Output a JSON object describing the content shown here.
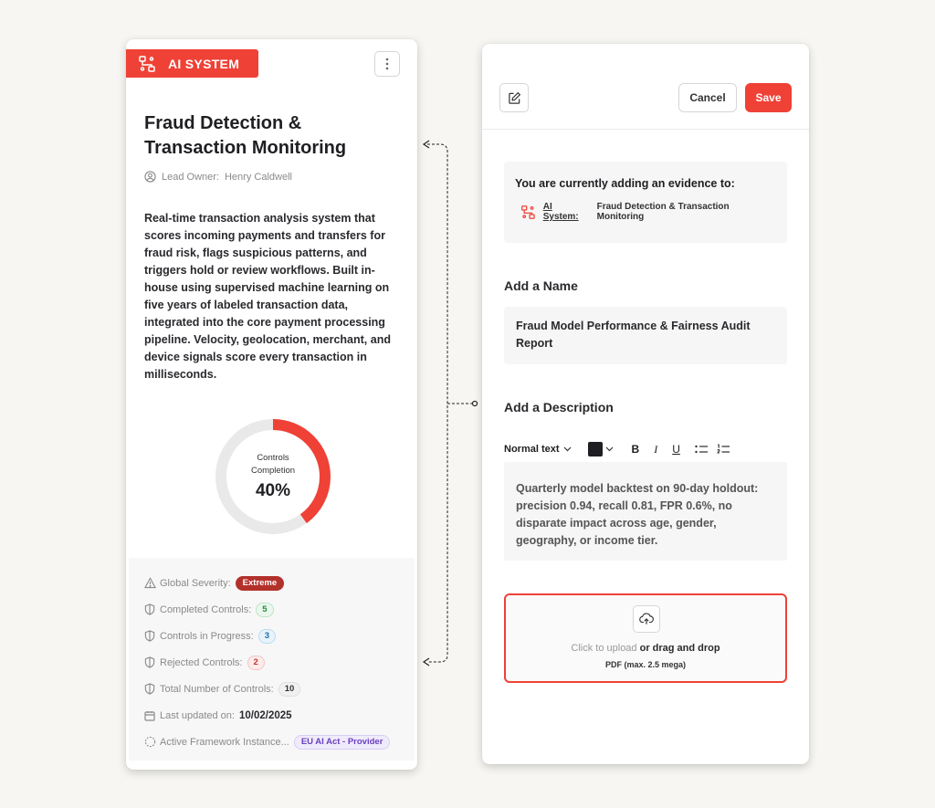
{
  "colors": {
    "accent": "#ef4136",
    "donut_track": "#e9e9e9"
  },
  "system_card": {
    "badge_label": "AI SYSTEM",
    "title": "Fraud Detection & Transaction Monitoring",
    "owner_label": "Lead Owner:",
    "owner_name": "Henry Caldwell",
    "description": "Real-time transaction analysis system that scores incoming payments and transfers for fraud risk, flags suspicious patterns, and triggers hold or review workflows. Built in-house using supervised machine learning on five years of labeled transaction data, integrated into the core payment processing pipeline. Velocity, geolocation, merchant, and device signals score every transaction in milliseconds.",
    "completion": {
      "label": "Controls Completion",
      "value_text": "40%",
      "fraction": 0.4
    },
    "stats": {
      "severity_label": "Global Severity:",
      "severity_value": "Extreme",
      "completed_label": "Completed Controls:",
      "completed_value": "5",
      "in_progress_label": "Controls in Progress:",
      "in_progress_value": "3",
      "rejected_label": "Rejected Controls:",
      "rejected_value": "2",
      "total_label": "Total Number of Controls:",
      "total_value": "10",
      "updated_label": "Last updated on:",
      "updated_value": "10/02/2025",
      "framework_label": "Active Framework Instance...",
      "framework_value": "EU AI Act - Provider"
    }
  },
  "evidence_form": {
    "cancel_label": "Cancel",
    "save_label": "Save",
    "context_title": "You are currently adding an evidence to:",
    "context_ref_label": "AI System:",
    "context_ref_value": "Fraud Detection & Transaction Monitoring",
    "name_heading": "Add a Name",
    "name_value": "Fraud Model Performance & Fairness Audit Report",
    "description_heading": "Add a Description",
    "editor": {
      "format_label": "Normal text",
      "bold": "B",
      "italic": "I",
      "underline": "U"
    },
    "description_value": "Quarterly model backtest on 90-day holdout: precision 0.94, recall 0.81, FPR 0.6%, no disparate impact across age, gender, geography, or income tier.",
    "upload": {
      "click_text": "Click to upload",
      "drag_text": "or drag and drop",
      "hint": "PDF (max. 2.5 mega)"
    }
  }
}
